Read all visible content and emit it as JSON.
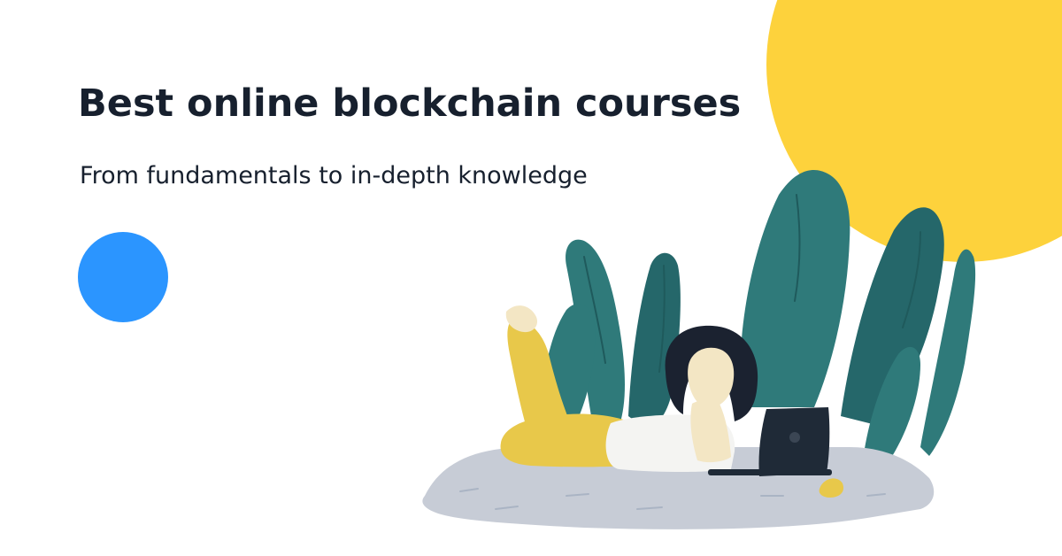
{
  "banner": {
    "headline": "Best online blockchain courses",
    "subheadline": "From fundamentals to in-depth knowledge"
  },
  "colors": {
    "text_dark": "#17202e",
    "accent_blue": "#2b95ff",
    "sun_yellow": "#fdd23c",
    "leaf_teal": "#2f7a7a",
    "leaf_teal_dark": "#25676a",
    "pants_yellow": "#e8c84a",
    "blanket_gray": "#c7ccd6",
    "laptop_dark": "#1f2a37"
  },
  "illustration": {
    "subject": "woman-lying-with-laptop-among-leaves"
  }
}
